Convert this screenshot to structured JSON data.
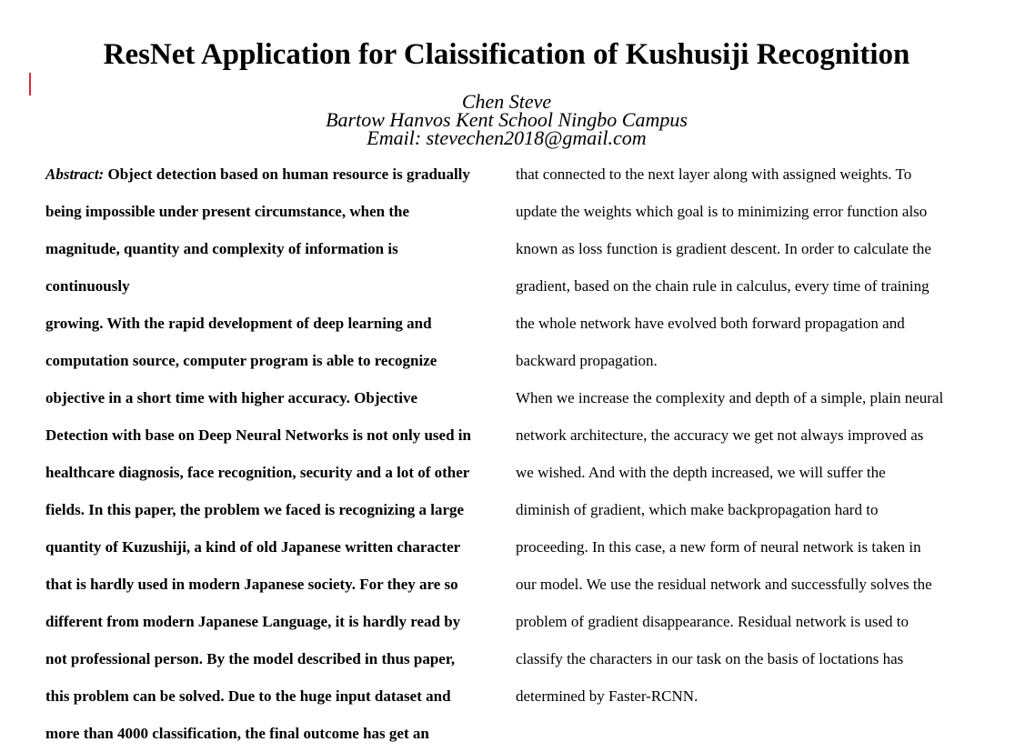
{
  "paper": {
    "title": "ResNet Application for Claissification of Kushusiji Recognition",
    "author_name": "Chen Steve",
    "affiliation": "Bartow Hanvos Kent School Ningbo Campus",
    "email": "Email: stevechen2018@gmail.com"
  },
  "abstract": {
    "label": "Abstract:",
    "lines": [
      " Object detection based on human resource is gradually",
      "being impossible under present circumstance, when the",
      "magnitude, quantity and complexity of information is",
      "continuously",
      " growing. With the rapid development of deep learning and",
      "computation source,  computer program is able to recognize",
      "objective in a short time with higher accuracy. Objective",
      "Detection with base on Deep Neural Networks is not only used in",
      "healthcare diagnosis, face recognition, security and a lot of other",
      "fields. In this paper, the problem we faced is recognizing a large",
      "quantity of Kuzushiji, a kind of old Japanese written character",
      "that is hardly used in modern Japanese society. For they are so",
      "different from modern Japanese Language, it is hardly read by",
      "not professional person. By the model described in thus paper,",
      "this problem can be solved.  Due to the huge input dataset and",
      "more than 4000 classification, the final outcome has  get an"
    ]
  },
  "right_column": {
    "lines": [
      "that connected to the next layer along with assigned weights. To",
      "update the weights which goal is to minimizing error function also",
      "known as loss function is gradient descent. In order to calculate the",
      "gradient, based on the chain rule in calculus, every time of training",
      "the whole network have evolved  both forward propagation and",
      "backward propagation.",
      "When we increase the complexity and depth of a simple, plain neural",
      "network architecture, the accuracy we get not always improved as",
      "we wished.  And with the depth increased, we will suffer the",
      "diminish of gradient, which make backpropagation hard to",
      "proceeding. In this case, a new form of neural network is taken in",
      "our model. We use the residual network and successfully solves the",
      "problem of gradient disappearance. Residual network is used to",
      "classify the characters in our task on the basis of loctations has",
      "determined by Faster-RCNN."
    ]
  }
}
